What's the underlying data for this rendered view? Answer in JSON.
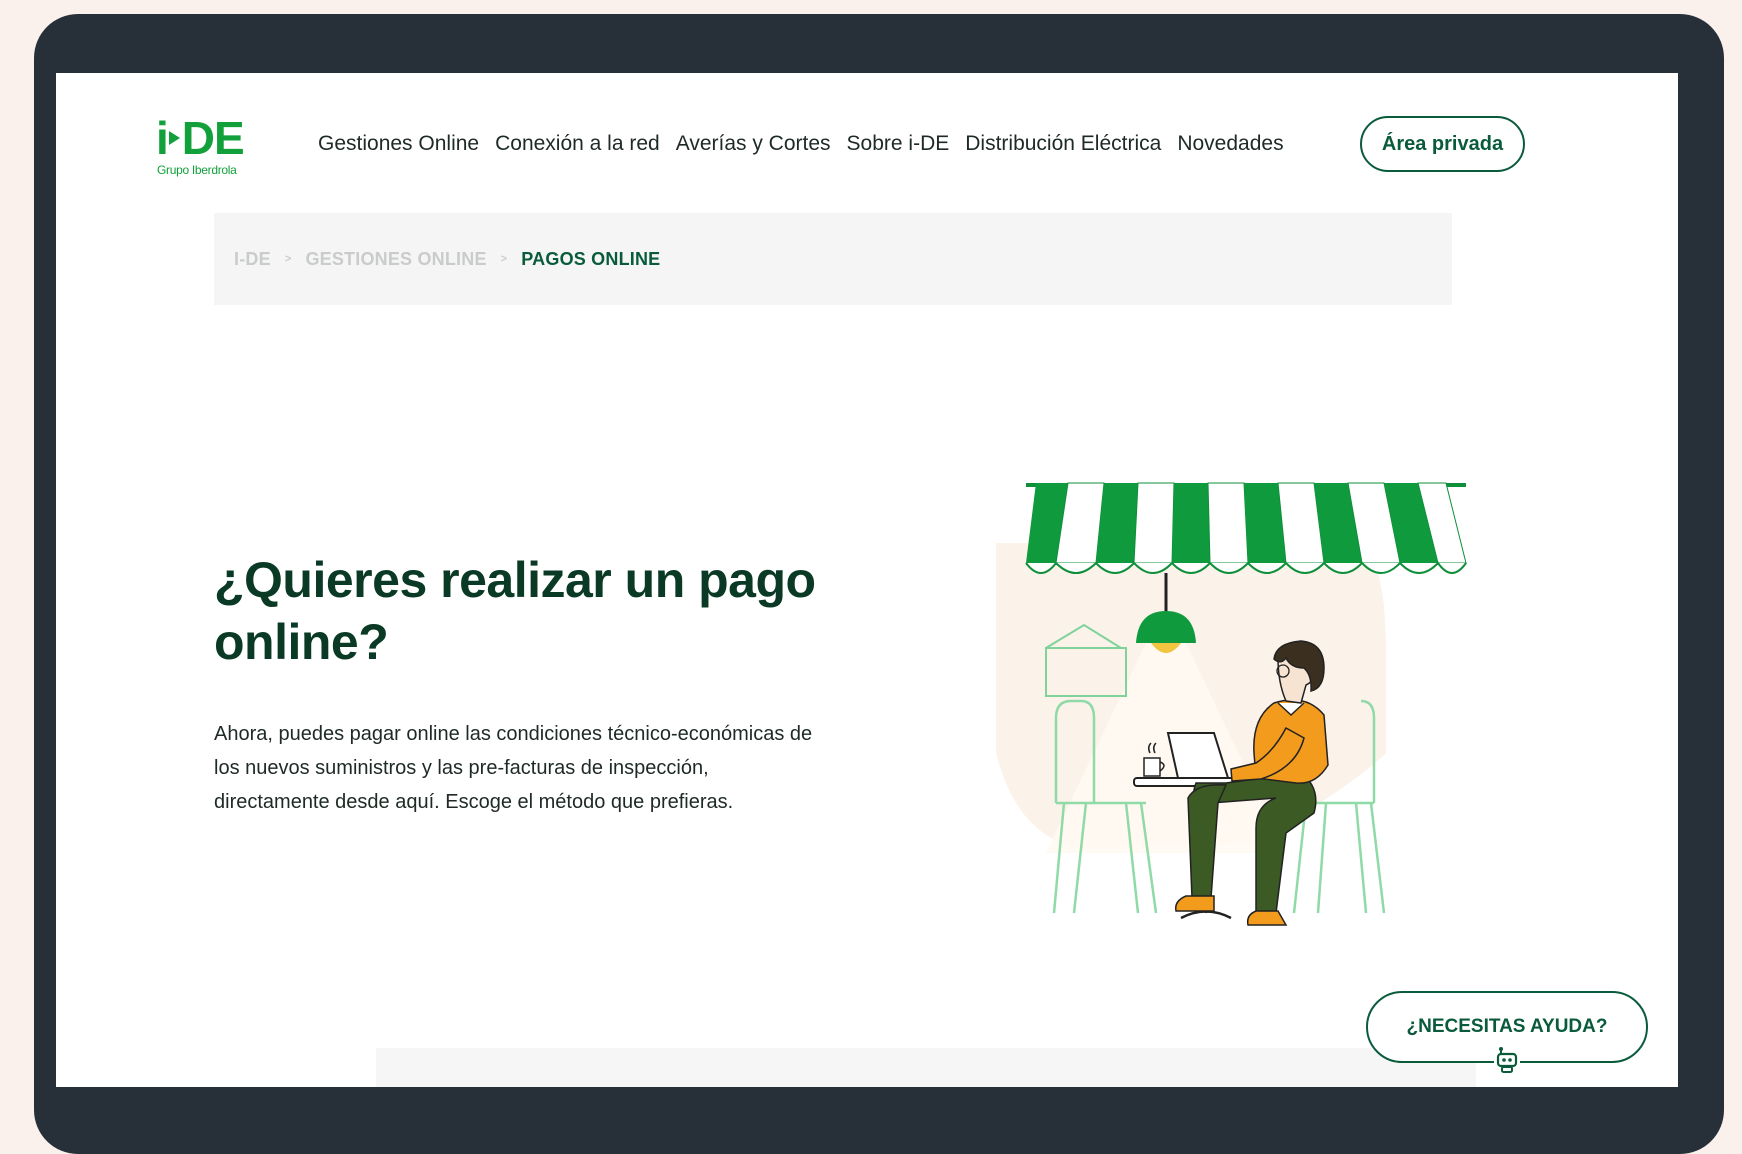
{
  "header": {
    "logo_text_a": "i",
    "logo_text_b": "DE",
    "logo_tagline": "Grupo Iberdrola",
    "nav": [
      {
        "label": "Gestiones Online"
      },
      {
        "label": "Conexión a la red"
      },
      {
        "label": "Averías y Cortes"
      },
      {
        "label": "Sobre i-DE"
      },
      {
        "label": "Distribución Eléctrica"
      },
      {
        "label": "Novedades"
      }
    ],
    "private_area_label": "Área privada"
  },
  "breadcrumb": {
    "items": [
      "I-DE",
      "GESTIONES ONLINE",
      "PAGOS ONLINE"
    ],
    "separator": ">"
  },
  "hero": {
    "title": "¿Quieres realizar un pago online?",
    "body": "Ahora, puedes pagar online las condiciones técnico-económicas de los nuevos suministros y las pre-facturas de inspección, directamente desde aquí. Escoge el método que prefieras."
  },
  "help": {
    "label": "¿NECESITAS AYUDA?",
    "icon": "robot-icon"
  },
  "colors": {
    "brand_green": "#12a03b",
    "dark_green": "#0a5b3b",
    "title_green": "#0a3a26",
    "awning_green": "#0f9a3e",
    "shirt_orange": "#f39b1d",
    "frame": "#273039"
  }
}
